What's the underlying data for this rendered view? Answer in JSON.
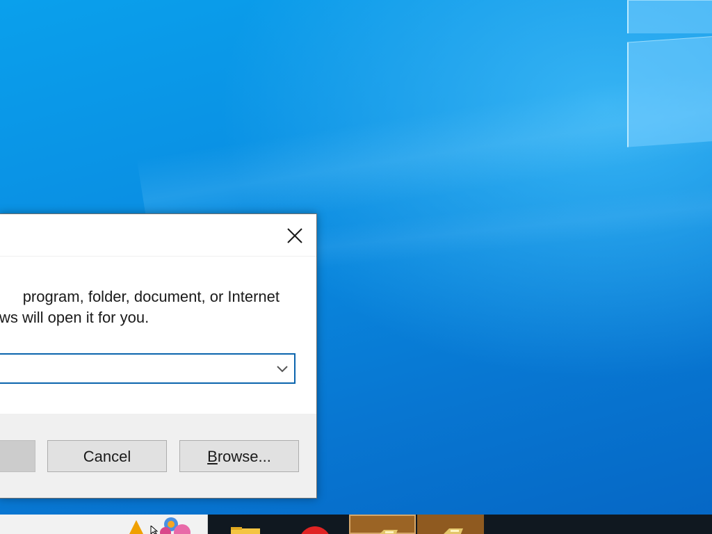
{
  "run_dialog": {
    "close_icon": "close-icon",
    "message_line1": "program, folder, document, or Internet",
    "message_line2": "ws will open it for you.",
    "open_value": "",
    "dropdown_icon": "chevron-down-icon",
    "ok_label": "",
    "cancel_label": "Cancel",
    "browse_label_first": "B",
    "browse_label_rest": "rowse..."
  },
  "taskbar": {
    "icons": [
      "warning-icon",
      "mouse-cursor-icon",
      "cortana-icon",
      "file-explorer-icon",
      "red-app-icon",
      "package-icon",
      "package-icon"
    ]
  },
  "colors": {
    "desktop_blue": "#0a8fe3",
    "focus_border": "#0a64ad",
    "taskbar_active": "#9b6425"
  }
}
